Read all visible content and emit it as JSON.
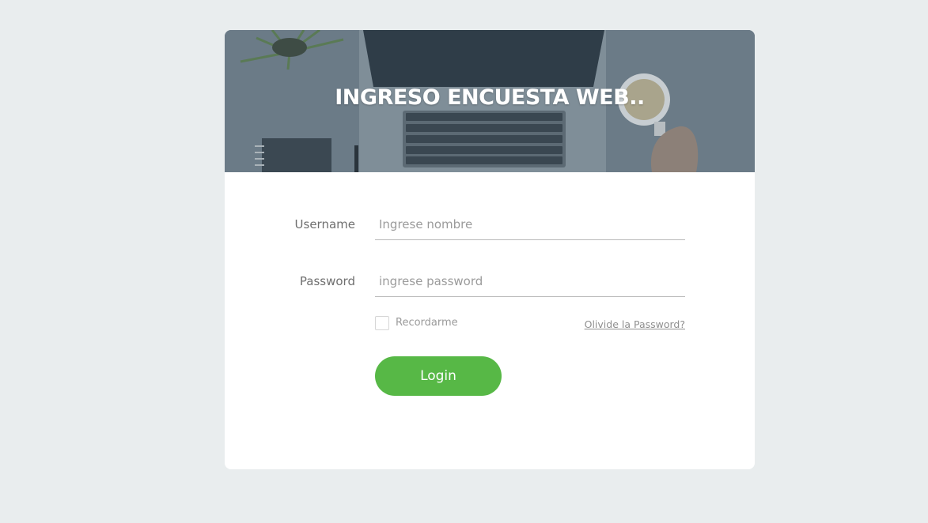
{
  "banner": {
    "title": "INGRESO ENCUESTA WEB.."
  },
  "form": {
    "username_label": "Username",
    "username_placeholder": "Ingrese nombre",
    "username_value": "",
    "password_label": "Password",
    "password_placeholder": "ingrese password",
    "password_value": "",
    "remember_label": "Recordarme",
    "remember_checked": false,
    "forgot_link": "Olivide la Password?",
    "login_label": "Login"
  },
  "colors": {
    "background": "#e9edee",
    "card": "#ffffff",
    "banner_overlay": "#6a7a86",
    "accent": "#57b846"
  }
}
